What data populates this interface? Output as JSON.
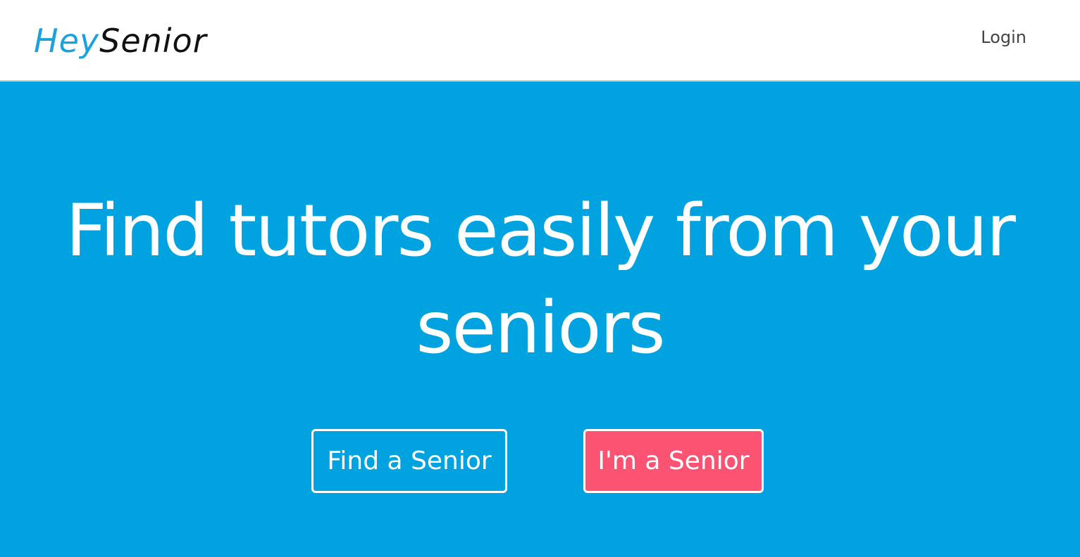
{
  "navbar": {
    "logo_part1": "Hey",
    "logo_part2": "Senior",
    "login_label": "Login"
  },
  "hero": {
    "headline": "Find tutors easily from your seniors",
    "find_button_label": "Find a Senior",
    "senior_button_label": "I'm a Senior"
  },
  "colors": {
    "brand_blue": "#00a3e0",
    "logo_blue": "#1ba1de",
    "accent_pink": "#fc5373",
    "text_white": "#ffffff"
  }
}
